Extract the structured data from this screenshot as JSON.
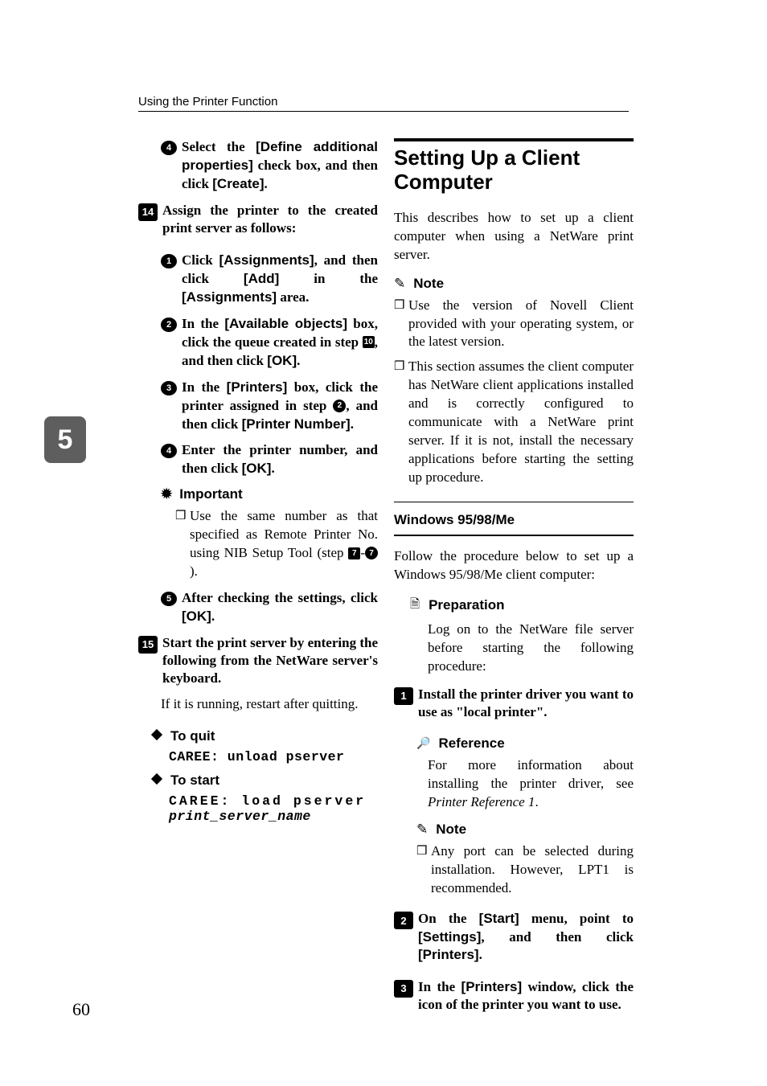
{
  "header": "Using the Printer Function",
  "chapter_tab": "5",
  "page_number": "60",
  "left": {
    "sub4_text_a": "Select the ",
    "sub4_ui1": "[Define additional properties]",
    "sub4_text_b": " check box, and then click ",
    "sub4_ui2": "[Create]",
    "sub4_text_c": ".",
    "step14": "14",
    "step14_text": "Assign the printer to the created print server as follows:",
    "s14_1": {
      "a": "Click ",
      "ui1": "[Assignments]",
      "b": ", and then click ",
      "ui2": "[Add]",
      "c": " in the ",
      "ui3": "[Assignments]",
      "d": " area."
    },
    "s14_2": {
      "a": "In the ",
      "ui1": "[Available objects]",
      "b": " box, click the queue created in step ",
      "ref": "10",
      "c": ", and then click ",
      "ui2": "[OK]",
      "d": "."
    },
    "s14_3": {
      "a": "In the ",
      "ui1": "[Printers]",
      "b": " box, click the printer assigned in step ",
      "ref": "2",
      "c": ", and then click ",
      "ui2": "[Printer Number]",
      "d": "."
    },
    "s14_4": {
      "a": "Enter the printer number, and then click ",
      "ui1": "[OK]",
      "b": "."
    },
    "important_label": "Important",
    "important_body_a": "Use the same number as that specified as Remote Printer No. using NIB Setup Tool (step ",
    "important_ref1": "7",
    "important_dash": "-",
    "important_ref2": "7",
    "important_body_b": ").",
    "s14_5": {
      "a": "After checking the settings, click ",
      "ui1": "[OK]",
      "b": "."
    },
    "step15": "15",
    "step15_text": "Start the print server by entering the following from the NetWare server's keyboard.",
    "step15_sub": "If it is running, restart after quitting.",
    "quit_label": "To quit",
    "quit_cmd": "CAREE: unload pserver",
    "start_label": "To start",
    "start_cmd1": "CAREE: load pserver",
    "start_cmd2": "print_server_name"
  },
  "right": {
    "title": "Setting Up a Client Computer",
    "intro": "This describes how to set up a client computer when using a NetWare print server.",
    "note_label": "Note",
    "note1": "Use the version of Novell Client provided with your operating system, or the latest version.",
    "note2": "This section assumes the client computer has NetWare client applications installed and is correctly configured to communicate with a NetWare print server. If it is not, install the necessary applications before starting the setting up procedure.",
    "win_heading": "Windows 95/98/Me",
    "win_intro": "Follow the procedure below to set up a Windows 95/98/Me client computer:",
    "prep_label": "Preparation",
    "prep_body": "Log on to the NetWare file server before starting the following procedure:",
    "step1": "1",
    "step1_text": "Install the printer driver you want to use as \"local printer\".",
    "ref_label": "Reference",
    "ref_body_a": "For more information about installing the printer driver, see ",
    "ref_body_i": "Printer Reference 1",
    "ref_body_b": ".",
    "note2_label": "Note",
    "note2_body": "Any port can be selected during installation. However, LPT1 is recommended.",
    "step2": "2",
    "step2_a": "On the ",
    "step2_ui1": "[Start]",
    "step2_b": " menu, point to ",
    "step2_ui2": "[Settings]",
    "step2_c": ", and then click ",
    "step2_ui3": "[Printers]",
    "step2_d": ".",
    "step3": "3",
    "step3_a": "In the ",
    "step3_ui1": "[Printers]",
    "step3_b": " window, click the icon of the printer you want to use."
  }
}
